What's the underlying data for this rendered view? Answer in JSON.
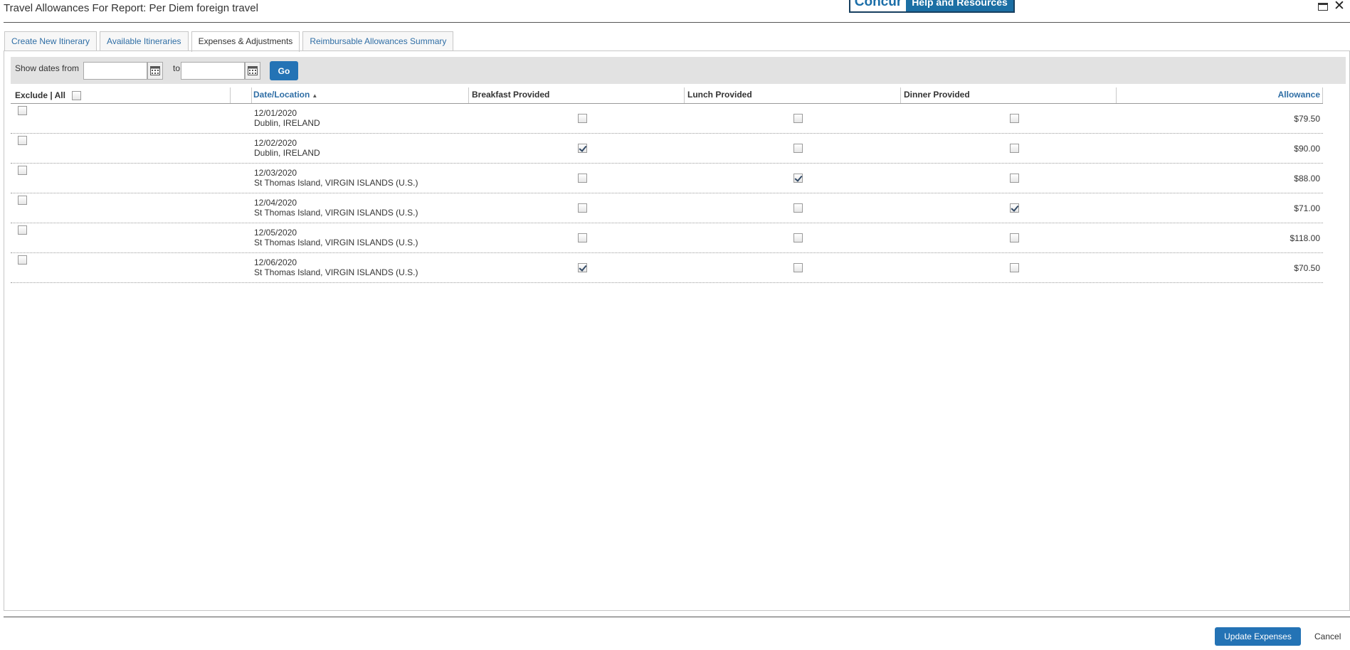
{
  "window": {
    "title": "Travel Allowances For Report: Per Diem foreign travel",
    "logo_brand": "Concur",
    "logo_help": "Help and Resources"
  },
  "tabs": [
    {
      "label": "Create New Itinerary",
      "active": false
    },
    {
      "label": "Available Itineraries",
      "active": false
    },
    {
      "label": "Expenses & Adjustments",
      "active": true
    },
    {
      "label": "Reimbursable Allowances Summary",
      "active": false
    }
  ],
  "filter": {
    "show_from_label": "Show dates from",
    "to_label": "to",
    "from_value": "",
    "to_value": "",
    "go_label": "Go"
  },
  "table": {
    "headers": {
      "exclude": "Exclude | All",
      "date_location": "Date/Location",
      "breakfast": "Breakfast Provided",
      "lunch": "Lunch Provided",
      "dinner": "Dinner Provided",
      "allowance": "Allowance"
    },
    "rows": [
      {
        "date": "12/01/2020",
        "location": "Dublin, IRELAND",
        "excluded": false,
        "breakfast": false,
        "lunch": false,
        "dinner": false,
        "allowance": "$79.50"
      },
      {
        "date": "12/02/2020",
        "location": "Dublin, IRELAND",
        "excluded": false,
        "breakfast": true,
        "lunch": false,
        "dinner": false,
        "allowance": "$90.00"
      },
      {
        "date": "12/03/2020",
        "location": "St Thomas Island, VIRGIN ISLANDS (U.S.)",
        "excluded": false,
        "breakfast": false,
        "lunch": true,
        "dinner": false,
        "allowance": "$88.00"
      },
      {
        "date": "12/04/2020",
        "location": "St Thomas Island, VIRGIN ISLANDS (U.S.)",
        "excluded": false,
        "breakfast": false,
        "lunch": false,
        "dinner": true,
        "allowance": "$71.00"
      },
      {
        "date": "12/05/2020",
        "location": "St Thomas Island, VIRGIN ISLANDS (U.S.)",
        "excluded": false,
        "breakfast": false,
        "lunch": false,
        "dinner": false,
        "allowance": "$118.00"
      },
      {
        "date": "12/06/2020",
        "location": "St Thomas Island, VIRGIN ISLANDS (U.S.)",
        "excluded": false,
        "breakfast": true,
        "lunch": false,
        "dinner": false,
        "allowance": "$70.50"
      }
    ]
  },
  "footer": {
    "update_label": "Update Expenses",
    "cancel_label": "Cancel"
  }
}
